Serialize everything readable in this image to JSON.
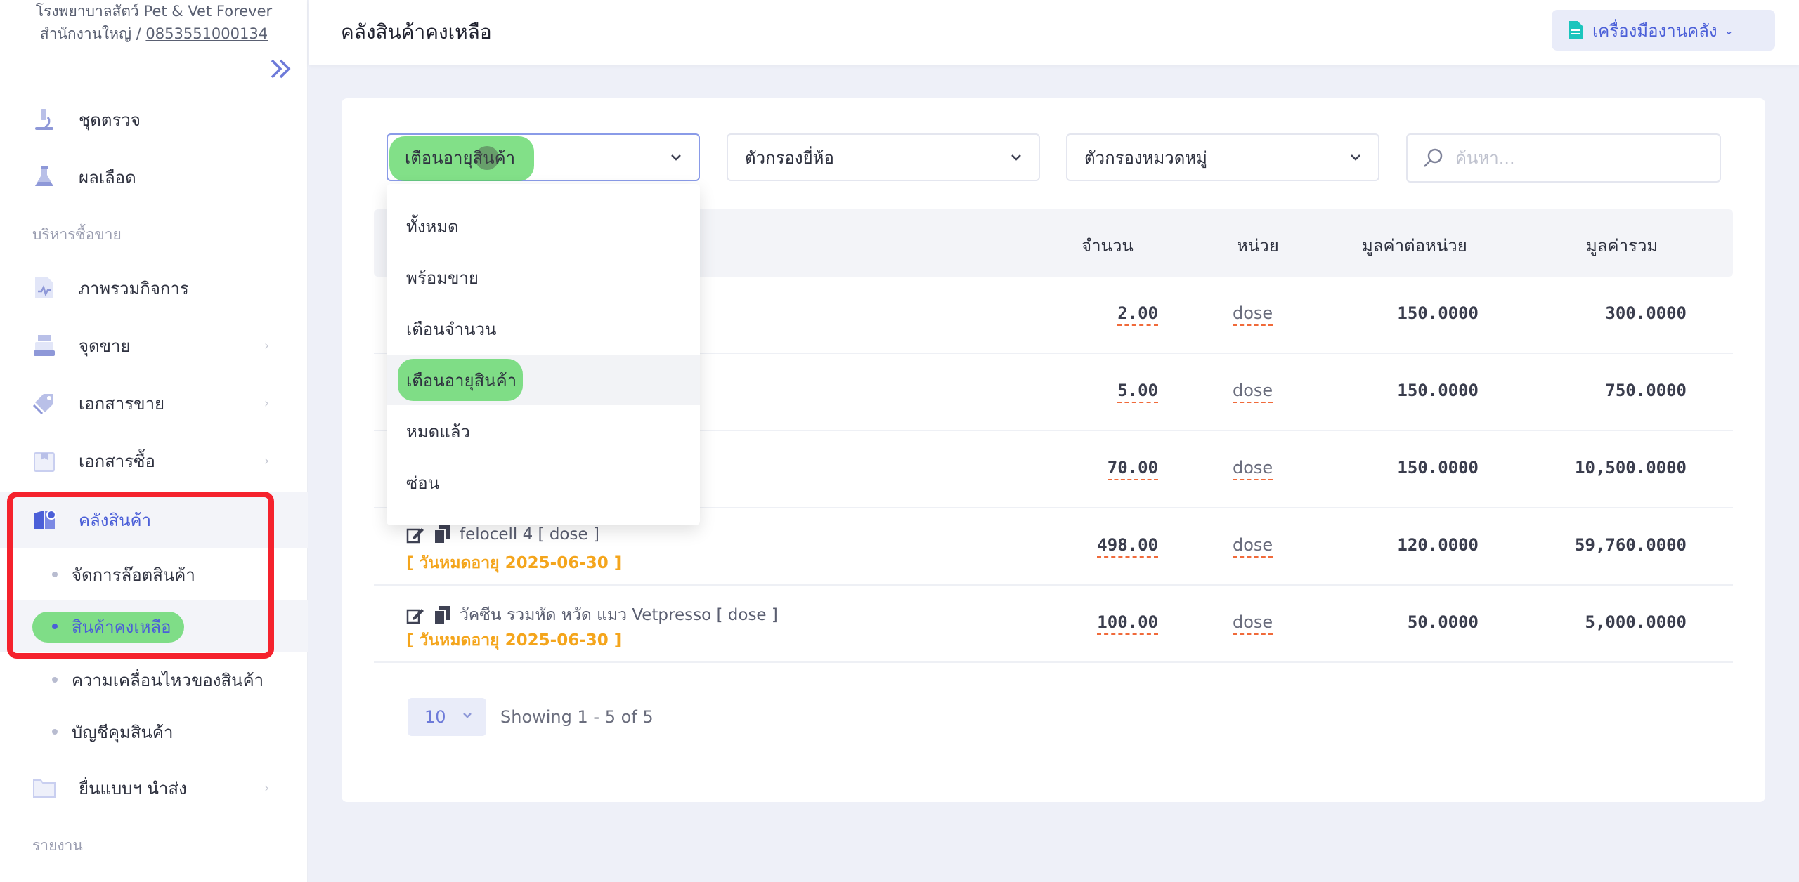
{
  "clinic": {
    "name": "โรงพยาบาลสัตว์ Pet & Vet Forever",
    "branch": "สำนักงานใหญ่ /",
    "phone": "0853551000134"
  },
  "sidebar": {
    "items": [
      {
        "label": "ชุดตรวจ",
        "icon": "microscope-icon"
      },
      {
        "label": "ผลเลือด",
        "icon": "flask-icon"
      }
    ],
    "section_sales": "บริหารซื้อขาย",
    "sales_items": [
      {
        "label": "ภาพรวมกิจการ",
        "icon": "chart-file-icon"
      },
      {
        "label": "จุดขาย",
        "icon": "cash-register-icon"
      },
      {
        "label": "เอกสารขาย",
        "icon": "tag-icon"
      },
      {
        "label": "เอกสารซื้อ",
        "icon": "box-icon"
      }
    ],
    "inventory": {
      "label": "คลังสินค้า",
      "icon": "inventory-icon"
    },
    "inventory_sub": [
      "จัดการล๊อตสินค้า",
      "สินค้าคงเหลือ",
      "ความเคลื่อนไหวของสินค้า",
      "บัญชีคุมสินค้า"
    ],
    "forms": {
      "label": "ยื่นแบบฯ นำส่ง",
      "icon": "folder-icon"
    },
    "section_reports": "รายงาน"
  },
  "header": {
    "title": "คลังสินค้าคงเหลือ",
    "tools_label": "เครื่องมืองานคลัง"
  },
  "filters": {
    "status_selected": "เตือนอายุสินค้า",
    "brand_placeholder": "ตัวกรองยี่ห้อ",
    "category_placeholder": "ตัวกรองหมวดหมู่",
    "search_placeholder": "ค้นหา..."
  },
  "dropdown_options": [
    "ทั้งหมด",
    "พร้อมขาย",
    "เตือนจำนวน",
    "เตือนอายุสินค้า",
    "หมดแล้ว",
    "ซ่อน"
  ],
  "table": {
    "headers": {
      "qty": "จำนวน",
      "unit": "หน่วย",
      "unit_value": "มูลค่าต่อหน่วย",
      "total": "มูลค่ารวม"
    },
    "rows": [
      {
        "name": "",
        "expiry": "",
        "qty": "2.00",
        "unit": "dose",
        "unit_value": "150.0000",
        "total": "300.0000"
      },
      {
        "name": "",
        "expiry": "",
        "qty": "5.00",
        "unit": "dose",
        "unit_value": "150.0000",
        "total": "750.0000"
      },
      {
        "name": "",
        "expiry": "",
        "qty": "70.00",
        "unit": "dose",
        "unit_value": "150.0000",
        "total": "10,500.0000"
      },
      {
        "name": "felocell 4 [ dose ]",
        "expiry": "[ วันหมดอายุ 2025-06-30 ]",
        "qty": "498.00",
        "unit": "dose",
        "unit_value": "120.0000",
        "total": "59,760.0000"
      },
      {
        "name": "วัคซีน รวมหัด หวัด แมว Vetpresso [ dose ]",
        "expiry": "[ วันหมดอายุ 2025-06-30 ]",
        "qty": "100.00",
        "unit": "dose",
        "unit_value": "50.0000",
        "total": "5,000.0000"
      }
    ]
  },
  "pagination": {
    "page_size": "10",
    "showing": "Showing 1 - 5 of 5"
  },
  "colors": {
    "accent": "#4b5fd8",
    "expiry": "#f4a51c",
    "highlight": "#58d660",
    "annotation": "#f5222d"
  }
}
